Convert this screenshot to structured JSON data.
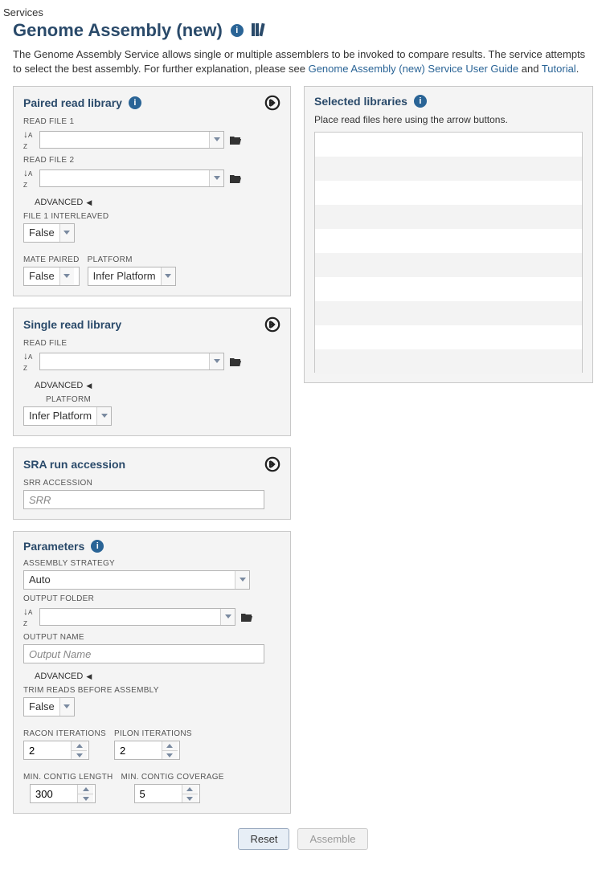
{
  "breadcrumb": "Services",
  "page_title": "Genome Assembly (new)",
  "description": {
    "text_before": "The Genome Assembly Service allows single or multiple assemblers to be invoked to compare results. The service attempts to select the best assembly. For further explanation, please see ",
    "link1": "Genome Assembly (new) Service User Guide",
    "mid": " and ",
    "link2": "Tutorial",
    "after": "."
  },
  "paired": {
    "title": "Paired read library",
    "read_file_1_label": "READ FILE 1",
    "read_file_2_label": "READ FILE 2",
    "advanced": "ADVANCED",
    "file1_interleaved_label": "FILE 1 INTERLEAVED",
    "file1_interleaved_value": "False",
    "mate_paired_label": "MATE PAIRED",
    "mate_paired_value": "False",
    "platform_label": "PLATFORM",
    "platform_value": "Infer Platform"
  },
  "single": {
    "title": "Single read library",
    "read_file_label": "READ FILE",
    "advanced": "ADVANCED",
    "platform_label": "PLATFORM",
    "platform_value": "Infer Platform"
  },
  "sra": {
    "title": "SRA run accession",
    "srr_label": "SRR ACCESSION",
    "srr_placeholder": "SRR"
  },
  "params": {
    "title": "Parameters",
    "assembly_strategy_label": "ASSEMBLY STRATEGY",
    "assembly_strategy_value": "Auto",
    "output_folder_label": "OUTPUT FOLDER",
    "output_name_label": "OUTPUT NAME",
    "output_name_placeholder": "Output Name",
    "advanced": "ADVANCED",
    "trim_label": "TRIM READS BEFORE ASSEMBLY",
    "trim_value": "False",
    "racon_label": "RACON ITERATIONS",
    "racon_value": "2",
    "pilon_label": "PILON ITERATIONS",
    "pilon_value": "2",
    "min_contig_len_label": "MIN. CONTIG LENGTH",
    "min_contig_len_value": "300",
    "min_contig_cov_label": "MIN. CONTIG COVERAGE",
    "min_contig_cov_value": "5"
  },
  "selected": {
    "title": "Selected libraries",
    "help": "Place read files here using the arrow buttons."
  },
  "buttons": {
    "reset": "Reset",
    "assemble": "Assemble"
  }
}
